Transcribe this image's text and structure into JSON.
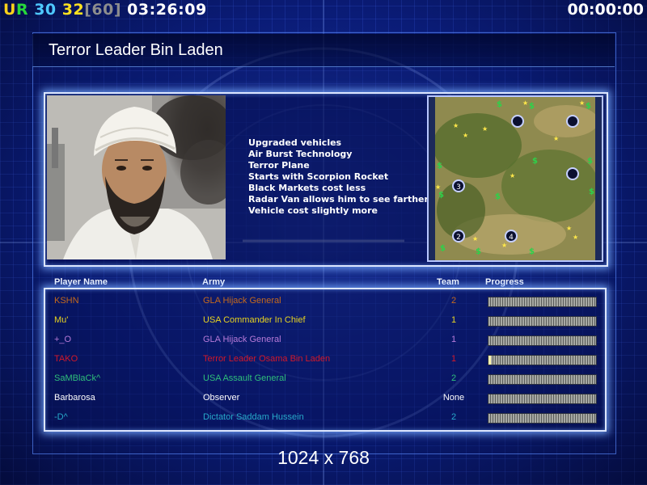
{
  "hud": {
    "ur_u": "U",
    "ur_r": "R",
    "count1": "30",
    "count2": "32",
    "count3": "[60]",
    "clock": "03:26:09",
    "timer": "00:00:00"
  },
  "general": {
    "title": "Terror Leader Bin Laden",
    "portrait_icon": "general-portrait",
    "bonuses": [
      "Upgraded vehicles",
      "Air Burst Technology",
      "Terror Plane",
      "Starts with Scorpion Rocket",
      "Black Markets cost less",
      "Radar Van allows him to see farther",
      "Vehicle cost slightly more"
    ]
  },
  "minimap": {
    "start_positions": [
      "",
      "",
      "3",
      "",
      "2",
      "4"
    ]
  },
  "players_table": {
    "headers": {
      "name": "Player Name",
      "army": "Army",
      "team": "Team",
      "progress": "Progress"
    },
    "rows": [
      {
        "name": "KSHN",
        "army": "GLA Hijack General",
        "team": "2",
        "color": "#c56a1c",
        "progress": 0
      },
      {
        "name": "Mu'",
        "army": "USA Commander In Chief",
        "team": "1",
        "color": "#e7d320",
        "progress": 0
      },
      {
        "name": "+_O",
        "army": "GLA Hijack General",
        "team": "1",
        "color": "#b77ad8",
        "progress": 0
      },
      {
        "name": "TAKO",
        "army": "Terror Leader Osama Bin Laden",
        "team": "1",
        "color": "#d3182a",
        "progress": 0.02
      },
      {
        "name": "SaMBlaCk^",
        "army": "USA Assault General",
        "team": "2",
        "color": "#2fbf7a",
        "progress": 0
      },
      {
        "name": "Barbarosa",
        "army": "Observer",
        "team": "None",
        "color": "#ffffff",
        "progress": 0
      },
      {
        "name": "-D^",
        "army": "Dictator Saddam Hussein",
        "team": "2",
        "color": "#27a9c9",
        "progress": 0
      }
    ]
  },
  "resolution": "1024 x 768",
  "colors": {
    "background": "#0a1c78",
    "panel_border": "#dce6ff",
    "glow": "#78aaff"
  }
}
